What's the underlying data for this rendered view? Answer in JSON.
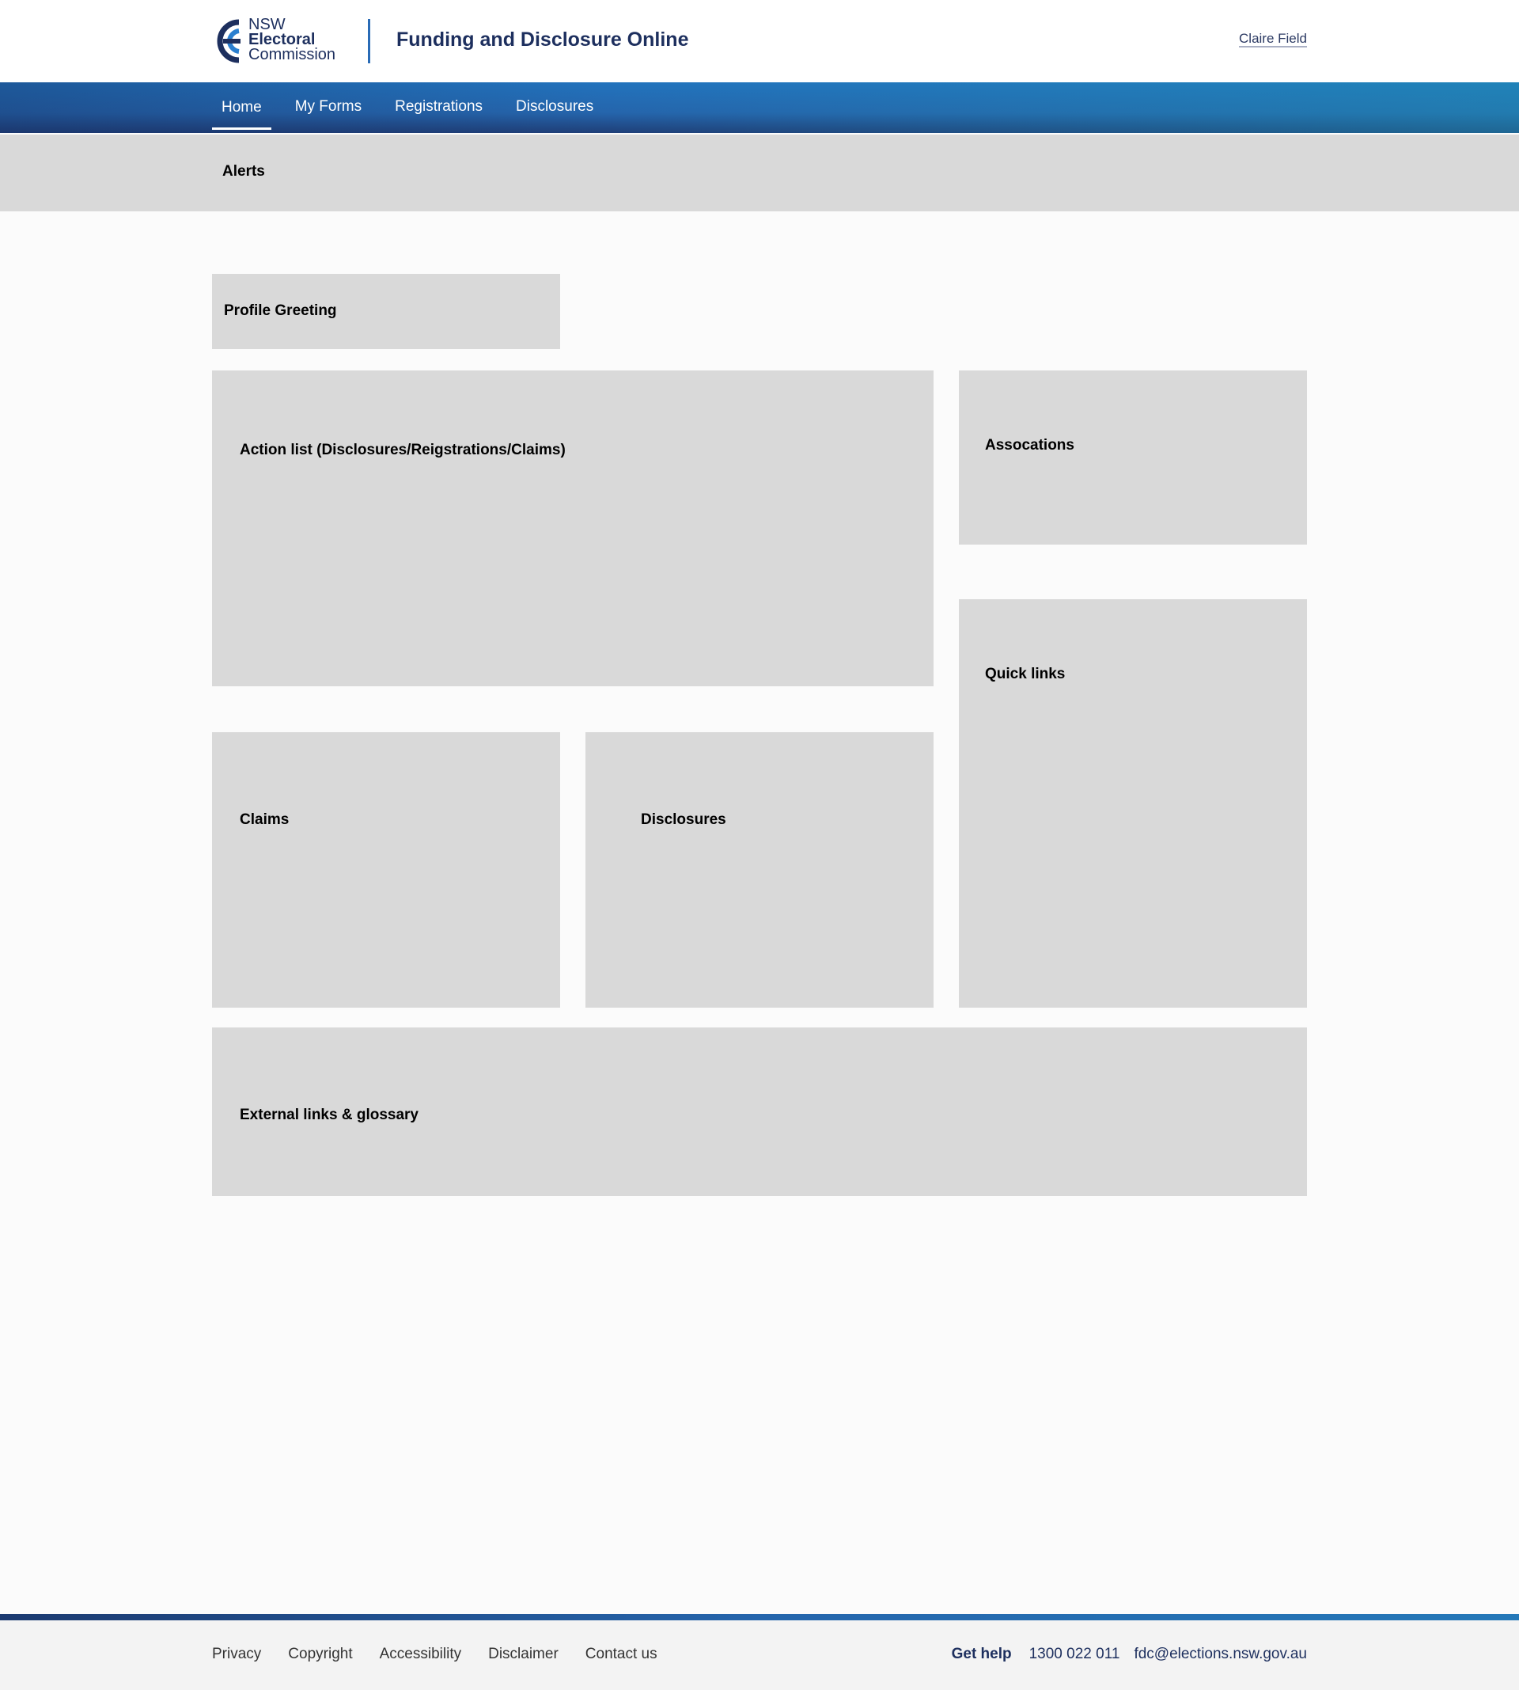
{
  "header": {
    "logo": {
      "line1": "NSW",
      "line2": "Electoral",
      "line3": "Commission",
      "icon": "nsw-electoral-commission-logo-icon"
    },
    "app_title": "Funding and Disclosure Online",
    "user_name": "Claire Field"
  },
  "nav": {
    "items": [
      {
        "label": "Home",
        "active": true
      },
      {
        "label": "My Forms",
        "active": false
      },
      {
        "label": "Registrations",
        "active": false
      },
      {
        "label": "Disclosures",
        "active": false
      }
    ]
  },
  "alerts": {
    "title": "Alerts"
  },
  "main": {
    "profile_greeting": "Profile Greeting",
    "action_list": "Action list (Disclosures/Reigstrations/Claims)",
    "associations": "Assocations",
    "quick_links": "Quick links",
    "claims": "Claims",
    "disclosures": "Disclosures",
    "external_links": "External links & glossary"
  },
  "footer": {
    "links": [
      "Privacy",
      "Copyright",
      "Accessibility",
      "Disclaimer",
      "Contact us"
    ],
    "help_label": "Get help",
    "phone": "1300 022 011",
    "email": "fdc@elections.nsw.gov.au"
  },
  "colors": {
    "brand_navy": "#1d2f5e",
    "brand_blue": "#2565ac",
    "placeholder_grey": "#d9d9d9"
  }
}
